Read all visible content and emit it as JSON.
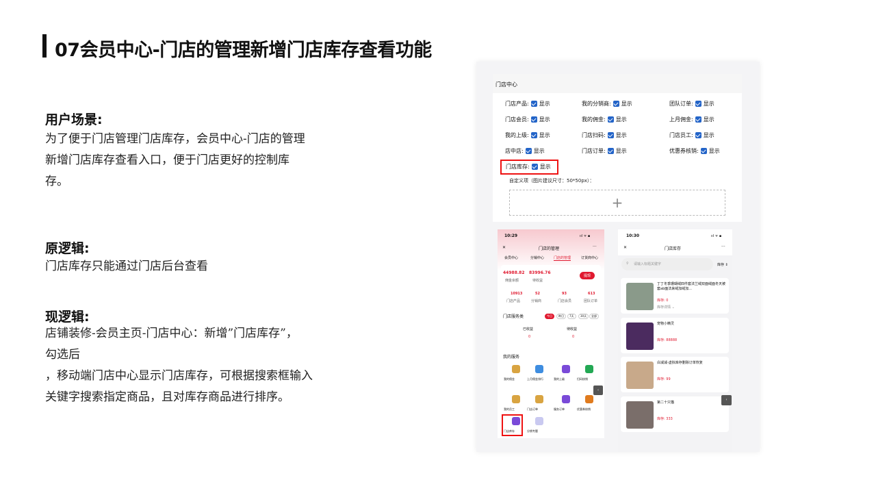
{
  "slide": {
    "title": "07会员中心-门店的管理新增门店库存查看功能",
    "scene_h": "用户场景:",
    "scene_lines": [
      "为了便于门店管理门店库存，会员中心-门店的管理",
      "新增门店库存查看入口，便于门店更好的控制库",
      "存。"
    ],
    "orig_h": "原逻辑:",
    "orig_p": "门店库存只能通过门店后台查看",
    "now_h": "现逻辑:",
    "now_lines": [
      "店铺装修-会员主页-门店中心：新增”门店库存”，",
      "勾选后",
      "，移动端门店中心显示门店库存，可根据搜索框输入",
      "关键字搜索指定商品，且对库存商品进行排序。"
    ]
  },
  "admin": {
    "header": "门店中心",
    "show": "显示",
    "items": [
      "门店产品:",
      "我的分销商:",
      "团队订单:",
      "门店会员:",
      "我的佣金:",
      "上月佣金:",
      "我的上级:",
      "门店扫码:",
      "门店员工:",
      "店中店:",
      "门店订单:",
      "优惠券核销:",
      "门店库存:"
    ],
    "custom": "自定义项（图片建议尺寸：50*50px）：",
    "upload": "+"
  },
  "p1": {
    "time": "10:29",
    "signal": "ııl ᯤ ▪",
    "close": "✕",
    "title": "门店的管理",
    "more": "···",
    "tabs": [
      "会员中心",
      "分销中心",
      "门店的管理",
      "订货商中心"
    ],
    "amt1": "44988.82",
    "amt1_l": "佣金余额",
    "amt2": "83996.76",
    "amt2_l": "待收益",
    "withdraw": "提现",
    "stats": [
      [
        "10913",
        "门店产品"
      ],
      [
        "52",
        "分销商"
      ],
      [
        "93",
        "门店会员"
      ],
      [
        "613",
        "团队订单"
      ]
    ],
    "svc": "门店服务类",
    "filters": [
      "今日",
      "昨日",
      "7天",
      "30天",
      "全部"
    ],
    "recv": "已收益",
    "recv_v": "0",
    "wait": "待收益",
    "wait_v": "0",
    "myservice": "我的服务",
    "icons": [
      "我的佣金",
      "上月佣金排行",
      "我的上级",
      "扫码核销",
      "我的员工",
      "门店订单",
      "服务订单",
      "优惠券核销",
      "门店库存",
      "分销专题"
    ],
    "back": "‹"
  },
  "p2": {
    "time": "10:30",
    "signal": "ııl ᯤ ▪",
    "close": "✕",
    "title": "门店库存",
    "more": "···",
    "search_ph": "请输入标题关键字",
    "sort": "库存 ⇕",
    "items": [
      {
        "name": "丁丁冬季珊瑚绒四件套法兰绒双面绒面冬天被套ab面法来绒加绒加...",
        "stock": "库存: 0",
        "detail": "库存详情 ⌄"
      },
      {
        "name": "宠物小精灵",
        "stock": "库存: 88888",
        "detail": ""
      },
      {
        "name": "白减减-虚拟库存删除订单恢复",
        "stock": "库存: 99",
        "detail": ""
      },
      {
        "name": "第二十只猫",
        "stock": "库存: 333",
        "detail": ""
      }
    ],
    "back": "‹"
  },
  "colors": {
    "accent": "#e0192f",
    "check": "#2364c8"
  }
}
